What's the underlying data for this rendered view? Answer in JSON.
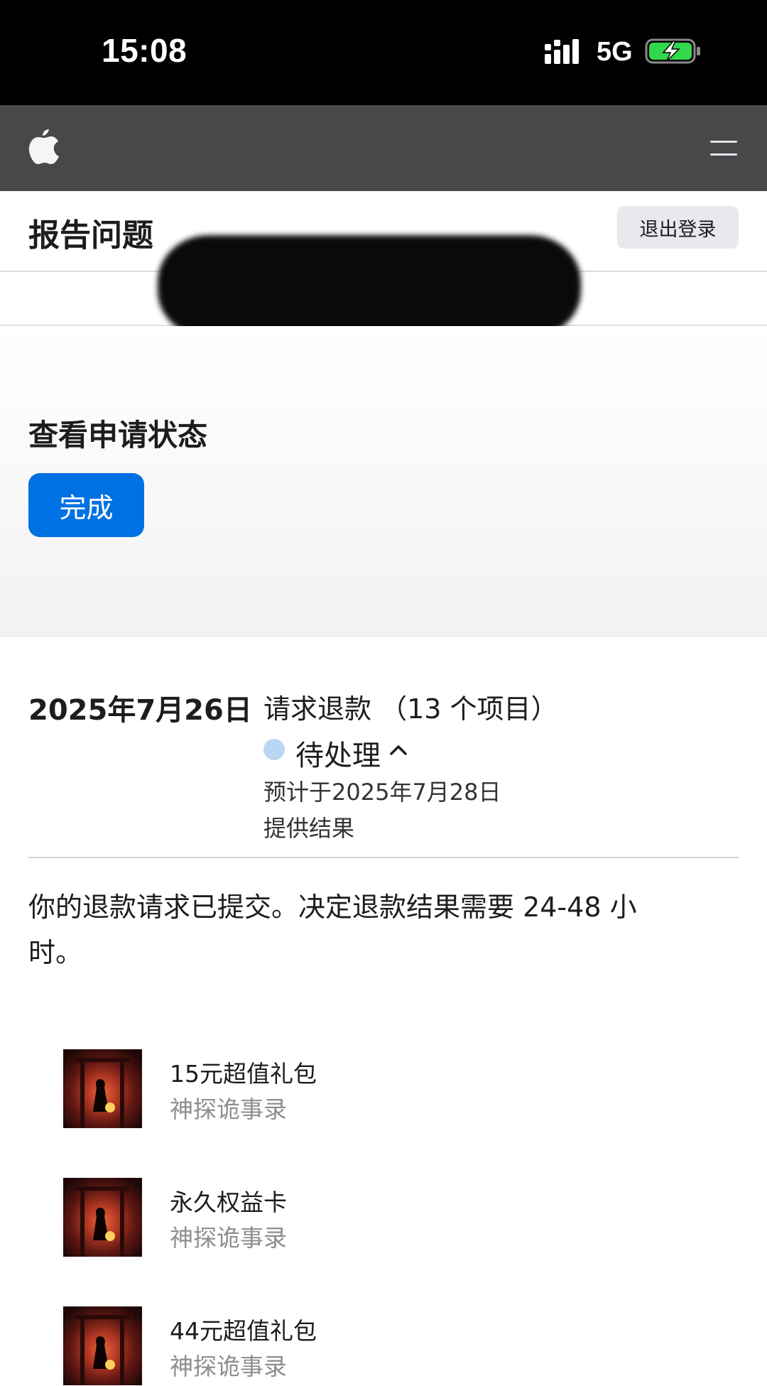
{
  "status_bar": {
    "time": "15:08",
    "network": "5G",
    "icons": [
      "signal-icon",
      "battery-charging-icon"
    ]
  },
  "nav": {
    "icons": [
      "apple-logo-icon",
      "menu-icon"
    ]
  },
  "header": {
    "title": "报告问题",
    "logout_label": "退出登录"
  },
  "hero": {
    "title": "查看申请状态",
    "done_label": "完成"
  },
  "request": {
    "date": "2025年7月26日",
    "title": "请求退款 （13 个项目）",
    "status": "待处理",
    "eta_line1": "预计于2025年7月28日",
    "eta_line2": "提供结果",
    "message": "你的退款请求已提交。决定退款结果需要 24-48 小时。"
  },
  "colors": {
    "accent": "#0071e3",
    "pending_dot": "#b9d6f2",
    "nav_bar": "#48484a"
  },
  "items": [
    {
      "name": "15元超值礼包",
      "app": "神探诡事录"
    },
    {
      "name": "永久权益卡",
      "app": "神探诡事录"
    },
    {
      "name": "44元超值礼包",
      "app": "神探诡事录"
    }
  ]
}
